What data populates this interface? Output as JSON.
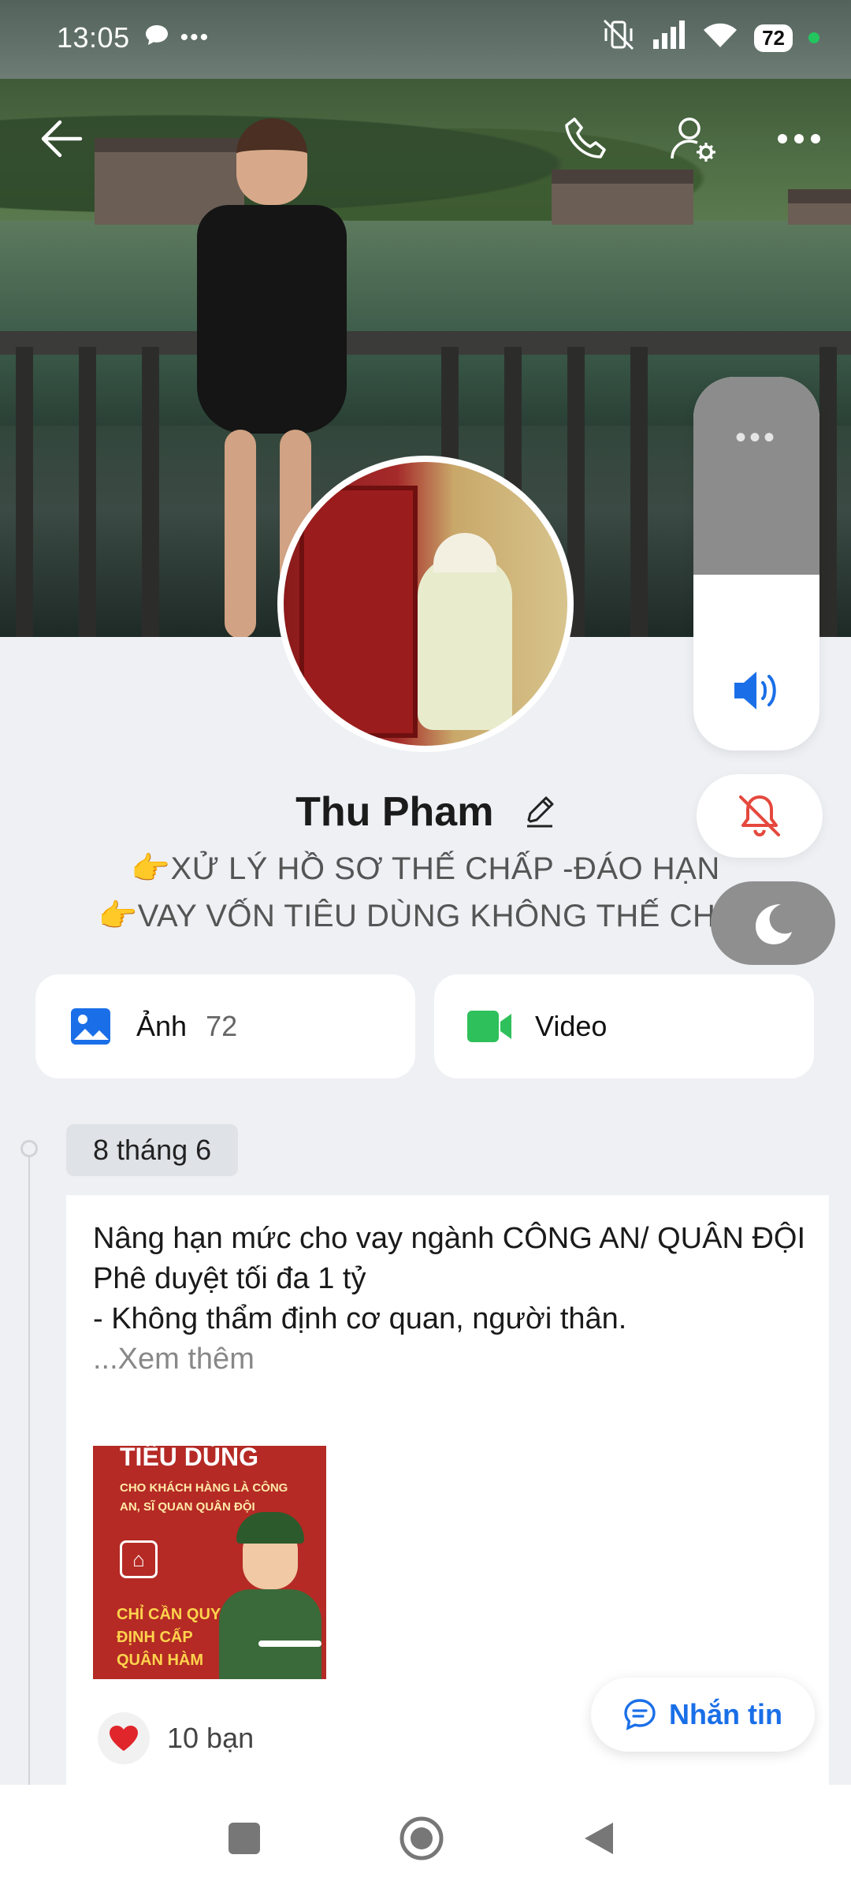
{
  "status_bar": {
    "time": "13:05",
    "battery": "72"
  },
  "profile": {
    "name": "Thu Pham",
    "bio_line1": "👉XỬ LÝ HỒ SƠ THẾ CHẤP -ĐÁO HẠN",
    "bio_line2": "👉VAY VỐN TIÊU DÙNG KHÔNG THẾ CHẤ"
  },
  "media": {
    "photos_label": "Ảnh",
    "photos_count": "72",
    "video_label": "Video"
  },
  "timeline": {
    "date": "8 tháng 6"
  },
  "post": {
    "line1": "Nâng hạn mức cho vay ngành CÔNG AN/ QUÂN ĐỘI",
    "line2": "Phê duyệt tối đa 1 tỷ",
    "line3": "- Không thẩm định cơ quan, người thân.",
    "see_more": "...Xem thêm",
    "image_title": "TIÊU DÙNG",
    "image_sub": "CHO KHÁCH HÀNG LÀ CÔNG AN, SĨ QUAN QUÂN ĐỘI",
    "image_cta": "CHỈ CẦN QUYẾT ĐỊNH CẤP QUÂN HÀM",
    "likes": "10 bạn"
  },
  "floating": {
    "message_button": "Nhắn tin",
    "volume_level": 0.47
  },
  "colors": {
    "accent_blue": "#1a6fe8",
    "mute_red": "#e5483d",
    "video_green": "#2ec05a"
  }
}
